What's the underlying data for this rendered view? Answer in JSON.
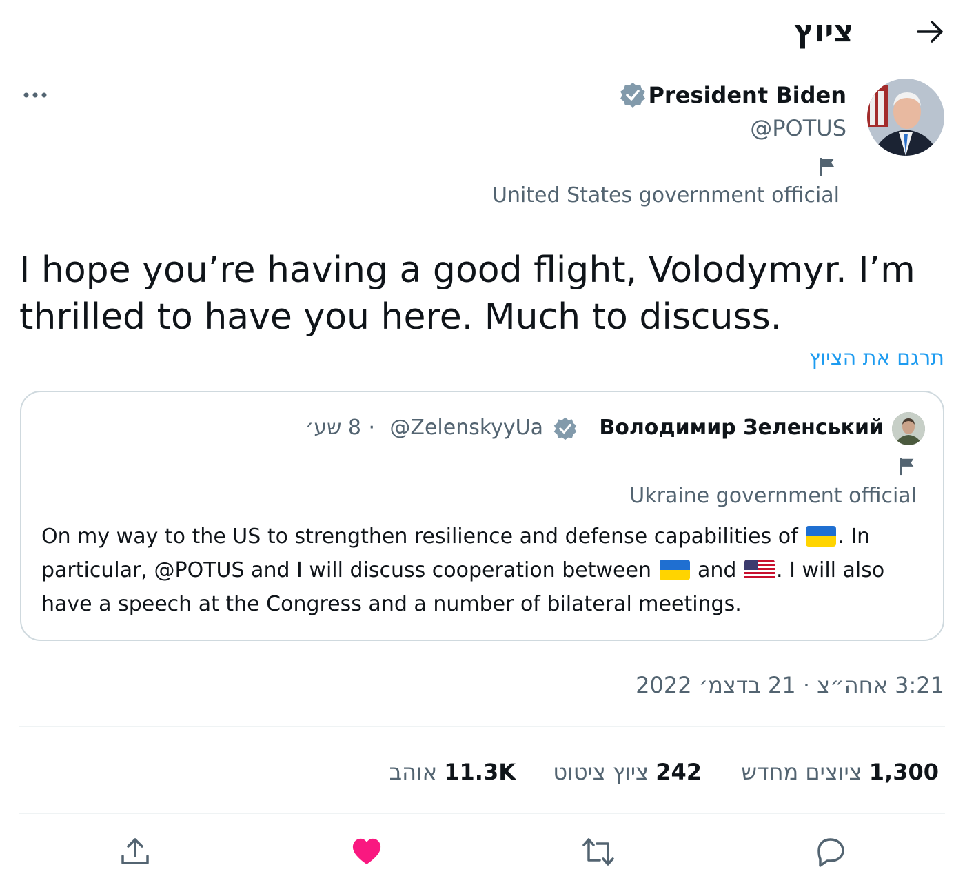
{
  "header": {
    "title": "ציוץ",
    "back_icon": "arrow-right-icon"
  },
  "author": {
    "name": "President Biden",
    "handle": "@POTUS",
    "label": "United States government official",
    "verified_icon": "verified-badge-icon"
  },
  "tweet": {
    "text": "I hope you’re having a good flight, Volodymyr. I’m thrilled to have you here. Much to discuss.",
    "translate": "תרגם את הציוץ"
  },
  "quote": {
    "name": "Володимир Зеленський",
    "handle": "@ZelenskyyUa",
    "dot": "·",
    "time": "8 שע׳",
    "label": "Ukraine government official",
    "text_1": "On my way to the US to strengthen resilience and defense capabilities of ",
    "text_2": ". In particular, @POTUS and I will discuss cooperation between ",
    "text_3": " and ",
    "text_4": ". I will also have a speech at the Congress and a number of bilateral meetings.",
    "flag_ua": "ukraine-flag-emoji",
    "flag_us": "us-flag-emoji"
  },
  "timestamp": "3:21 אחה״צ · 21 בדצמ׳ 2022",
  "stats": {
    "retweets_count": "1,300",
    "retweets_label": "ציוצים מחדש",
    "quotes_count": "242",
    "quotes_label": "ציוץ ציטוט",
    "likes_count": "11.3K",
    "likes_label": "אוהב"
  },
  "actions": [
    "share-icon",
    "heart-icon",
    "retweet-icon",
    "reply-icon"
  ],
  "colors": {
    "accent": "#1d9bf0",
    "like": "#f91880",
    "secondary_text": "#536471",
    "verified": "#829aab"
  }
}
